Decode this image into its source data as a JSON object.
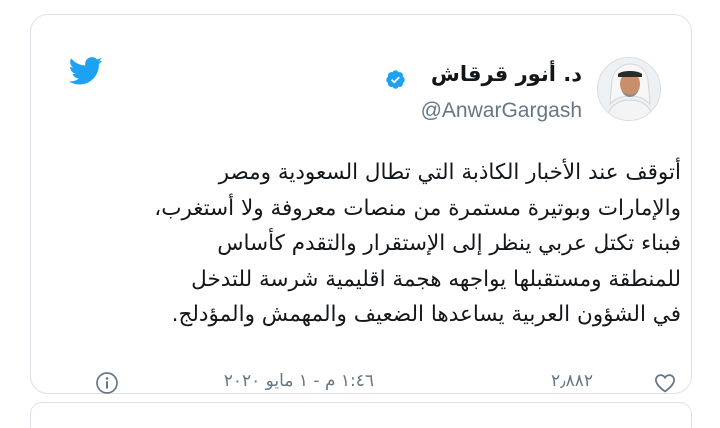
{
  "tweet": {
    "author": {
      "display_name": "د. أنور قرقاش",
      "handle": "@AnwarGargash",
      "verified": true
    },
    "text_lines": [
      "أتوقف عند الأخبار الكاذبة التي تطال السعودية ومصر",
      "والإمارات وبوتيرة مستمرة من منصات معروفة ولا أستغرب،",
      "فبناء تكتل عربي ينظر إلى الإستقرار والتقدم كأساس",
      "للمنطقة ومستقبلها يواجهه هجمة اقليمية شرسة للتدخل",
      "في الشؤون العربية يساعدها الضعيف والمهمش والمؤدلج."
    ],
    "likes": "٢٫٨٨٢",
    "timestamp": "١:٤٦ م - ١ مايو ٢٠٢٠"
  },
  "icons": {
    "brand": "twitter-bird-icon",
    "verified": "verified-badge-icon",
    "like": "heart-outline-icon",
    "info": "info-circle-icon"
  },
  "colors": {
    "twitter_blue": "#1da1f2",
    "text_primary": "#14171a",
    "text_secondary": "#657786",
    "border": "#dfe3e7"
  }
}
